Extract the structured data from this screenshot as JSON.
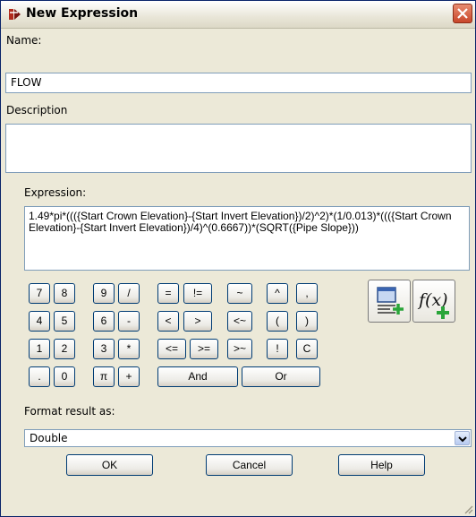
{
  "window": {
    "title": "New Expression"
  },
  "name": {
    "label": "Name:",
    "value": "FLOW"
  },
  "description": {
    "label": "Description",
    "value": ""
  },
  "expression": {
    "label": "Expression:",
    "value": "1.49*pi*((({Start Crown Elevation}-{Start Invert Elevation})/2)^2)*(1/0.013)*((({Start Crown Elevation}-{Start Invert Elevation})/4)^(0.6667))*(SQRT({Pipe Slope}))"
  },
  "keypad": {
    "k7": "7",
    "k8": "8",
    "k9": "9",
    "div": "/",
    "k4": "4",
    "k5": "5",
    "k6": "6",
    "minus": "-",
    "k1": "1",
    "k2": "2",
    "k3": "3",
    "mul": "*",
    "dot": ".",
    "k0": "0",
    "pi": "π",
    "plus": "+",
    "eq": "=",
    "ne": "!=",
    "approx": "~",
    "lt": "<",
    "gt": ">",
    "notapprox": "<~",
    "le": "<=",
    "ge": ">=",
    "gtapprox": ">~",
    "and": "And",
    "or": "Or",
    "caret": "^",
    "comma": ",",
    "lparen": "(",
    "rparen": ")",
    "not": "!",
    "clear": "C"
  },
  "format": {
    "label": "Format result as:",
    "value": "Double"
  },
  "buttons": {
    "ok": "OK",
    "cancel": "Cancel",
    "help": "Help"
  },
  "icons": {
    "insert_property": "insert-property-icon",
    "insert_function": "insert-function-icon"
  },
  "colors": {
    "accent_green": "#2aa53a",
    "close_red": "#c8462a"
  }
}
